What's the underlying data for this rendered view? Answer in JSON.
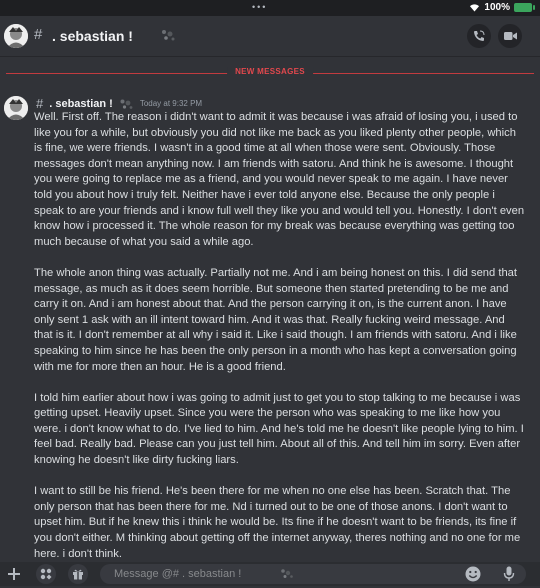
{
  "status": {
    "battery": "100%"
  },
  "header": {
    "hash": "#",
    "channel": ".   sebastian   !"
  },
  "divider": {
    "label": "NEW MESSAGES"
  },
  "message": {
    "hash": "#",
    "author": ".   sebastian   !",
    "timestamp": "Today at 9:32 PM",
    "paragraphs": [
      "Well. First off. The reason i didn't want to admit it was because i was afraid of losing you, i used to like you for a while, but obviously you did not like me back as you liked plenty other people, which is fine, we were friends. I wasn't in a good time at all when those were sent. Obviously. Those messages don't mean anything now. I am friends with satoru. And think he is awesome. I thought you were going to replace me as a friend, and you would never speak to me again. I have never told you about how i truly felt. Neither have i ever told anyone else. Because the only people i speak to are your friends and i know full well they like you and would tell you. Honestly. I don't even know how i processed it. The whole reason for my  break was because everything was getting too much because of what you said a while ago.",
      "The whole anon thing was actually. Partially not me. And i am being honest on this. I did send that message, as much as it does seem horrible. But someone then started pretending to be me and carry it on. And i am honest about that. And the person carrying it on, is the current anon. I have only sent 1 ask with an ill intent toward him. And it was that. Really fucking weird message. And that is it. I don't remember at all why i said it. Like i said though. I am friends with satoru. And i like speaking to him since he has been the only person in a month who has kept a conversation going with me for more then an hour. He is a good friend.",
      "I told him earlier about how i was going to admit just to get you to stop talking to me because i was getting upset. Heavily upset. Since you were the person who was speaking to me like how you were. i don't know what to do. I've lied to him. And he's told me he doesn't like people lying to him. I feel bad. Really bad. Please can you just tell him. About all of this. And tell him im sorry. Even after knowing he doesn't like dirty fucking liars.",
      "I want to still be his friend. He's been there for me when no one else has been. Scratch that. The only person that has been there for me. Nd i turned out to be one of those anons. I don't want to upset him. But if he knew this i think he would be. Its fine if he doesn't want to be friends, its fine if you don't either. M thinking about getting off the internet anyway, theres nothing and no one for me here. i don't think."
    ]
  },
  "composer": {
    "placeholder": "Message @#  .   sebastian   !"
  },
  "icons": {
    "header_left": "avatar",
    "header_right": [
      "phone-icon",
      "video-icon"
    ],
    "composer_left": [
      "plus-icon",
      "apps-icon",
      "gift-icon"
    ],
    "composer_right": [
      "emoji-icon",
      "microphone-icon"
    ]
  },
  "colors": {
    "accent_red": "#e3484d",
    "background": "#313338",
    "battery": "#3ba55d"
  }
}
